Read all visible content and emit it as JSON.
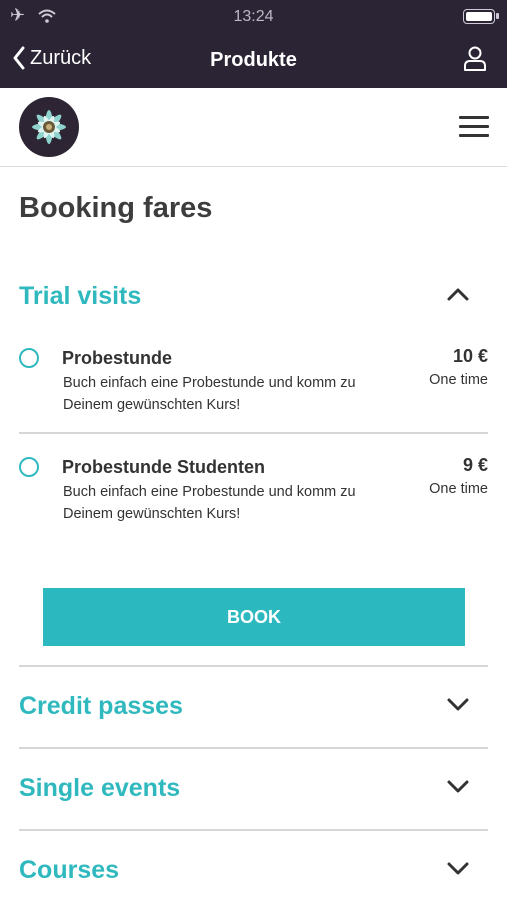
{
  "status_bar": {
    "time": "13:24"
  },
  "nav": {
    "back_label": "Zurück",
    "title": "Produkte"
  },
  "page": {
    "title": "Booking fares"
  },
  "trial_section": {
    "title": "Trial visits",
    "fares": [
      {
        "name": "Probestunde",
        "price": "10 €",
        "description": "Buch einfach eine Probestunde und komm zu Deinem gewünschten Kurs!",
        "frequency": "One time"
      },
      {
        "name": "Probestunde Studenten",
        "price": "9 €",
        "description": "Buch einfach eine Probestunde und komm zu Deinem gewünschten Kurs!",
        "frequency": "One time"
      }
    ],
    "book_label": "BOOK"
  },
  "collapsed_sections": [
    {
      "title": "Credit passes"
    },
    {
      "title": "Single events"
    },
    {
      "title": "Courses"
    }
  ],
  "colors": {
    "accent": "#2fb9bf",
    "topbar": "#2a2434",
    "button": "#2cb8bf"
  },
  "icons": [
    "airplane-icon",
    "wifi-icon",
    "battery-icon",
    "chevron-left-icon",
    "user-icon",
    "logo-flower",
    "hamburger-menu-icon",
    "chevron-up-icon",
    "chevron-down-icon"
  ]
}
